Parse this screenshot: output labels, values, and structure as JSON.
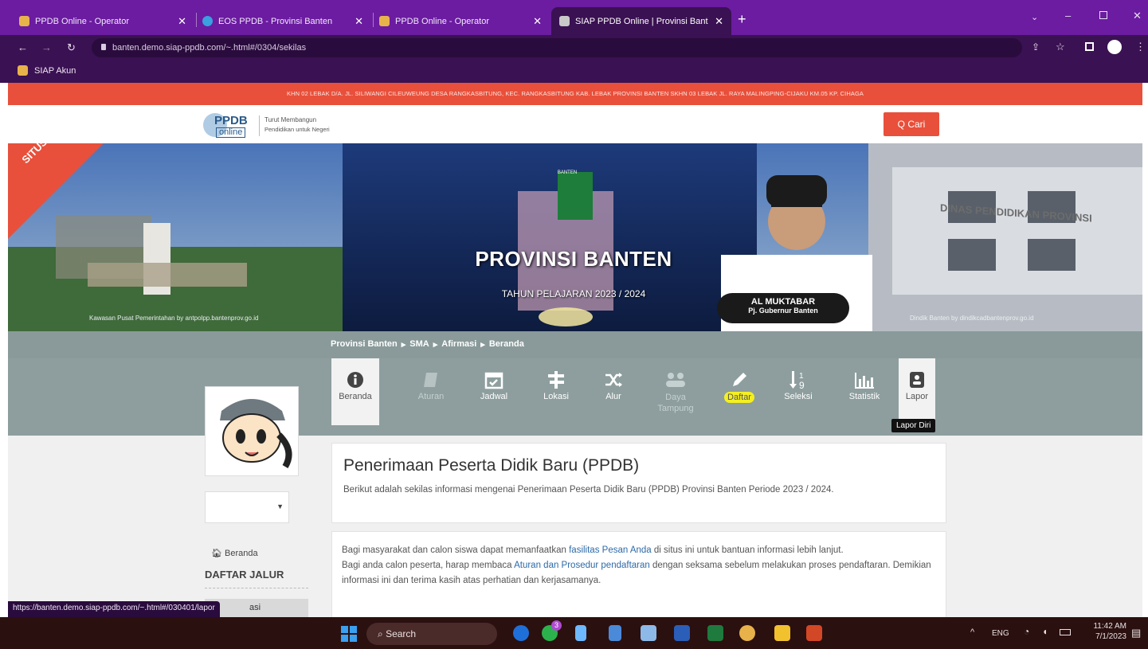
{
  "browser": {
    "tabs": [
      {
        "title": "PPDB Online - Operator",
        "color": "#e8b24a"
      },
      {
        "title": "EOS PPDB - Provinsi Banten",
        "color": "#3aa0e0"
      },
      {
        "title": "PPDB Online - Operator",
        "color": "#e8b24a"
      },
      {
        "title": "SIAP PPDB Online | Provinsi Bant",
        "color": "#e8b24a"
      }
    ],
    "url": "banten.demo.siap-ppdb.com/~.html#/0304/sekilas",
    "bookmark": "SIAP Akun",
    "status_url": "https://banten.demo.siap-ppdb.com/~.html#/030401/lapor"
  },
  "page": {
    "address": "KHN 02 LEBAK D/A. JL. SILIWANGI CILEUWEUNG DESA RANGKASBITUNG, KEC. RANGKASBITUNG KAB. LEBAK PROVINSI BANTEN SKHN 03 LEBAK JL. RAYA MALINGPING-CIJAKU KM.05 KP. CIHAGA",
    "logo": {
      "brand": "PPDB",
      "sub": "online",
      "tagline1": "Turut Membangun",
      "tagline2": "Pendidikan untuk Negeri"
    },
    "search_label": "Q Cari",
    "banner": {
      "ribbon": "SITUS DEMO",
      "title": "PROVINSI BANTEN",
      "subtitle": "TAHUN PELAJARAN 2023 / 2024",
      "name": "AL MUKTABAR",
      "role": "Pj. Gubernur Banten",
      "credit_left": "Kawasan Pusat Pemerintahan by antpolpp.bantenprov.go.id",
      "credit_right": "Dindik Banten by dindikcadbantenprov.go.id",
      "building_sign": "DINAS PENDIDIKAN PROVINSI",
      "seal_text": "BANTEN"
    },
    "breadcrumb": [
      "Provinsi Banten",
      "SMA",
      "Afirmasi",
      "Beranda"
    ],
    "menu": [
      {
        "label": "Beranda",
        "icon": "info-icon"
      },
      {
        "label": "Aturan",
        "icon": "book-icon"
      },
      {
        "label": "Jadwal",
        "icon": "calendar-icon"
      },
      {
        "label": "Lokasi",
        "icon": "signpost-icon"
      },
      {
        "label": "Alur",
        "icon": "shuffle-icon"
      },
      {
        "label": "Daya Tampung",
        "icon": "users-icon"
      },
      {
        "label": "Daftar",
        "icon": "pencil-icon"
      },
      {
        "label": "Seleksi",
        "icon": "sort-numeric-icon"
      },
      {
        "label": "Statistik",
        "icon": "bar-chart-icon"
      },
      {
        "label": "Lapor",
        "icon": "contact-card-icon"
      }
    ],
    "tooltip": "Lapor Diri",
    "sidebar": {
      "home": "Beranda",
      "section": "DAFTAR JALUR",
      "item_partial": "asi"
    },
    "intro": {
      "title": "Penerimaan Peserta Didik Baru (PPDB)",
      "text": "Berikut adalah sekilas informasi mengenai Penerimaan Peserta Didik Baru (PPDB) Provinsi Banten Periode 2023 / 2024."
    },
    "info": {
      "p1a": "Bagi masyarakat dan calon siswa dapat memanfaatkan ",
      "p1link": "fasilitas Pesan Anda",
      "p1b": " di situs ini untuk bantuan informasi lebih lanjut.",
      "p2a": "Bagi anda calon peserta, harap membaca ",
      "p2link": "Aturan dan Prosedur pendaftaran",
      "p2b": " dengan seksama sebelum melakukan proses pendaftaran. Demikian informasi ini dan terima kasih atas perhatian dan kerjasamanya."
    }
  },
  "taskbar": {
    "search": "Search",
    "lang": "ENG",
    "time": "11:42 AM",
    "date": "7/1/2023",
    "badge": "3"
  }
}
